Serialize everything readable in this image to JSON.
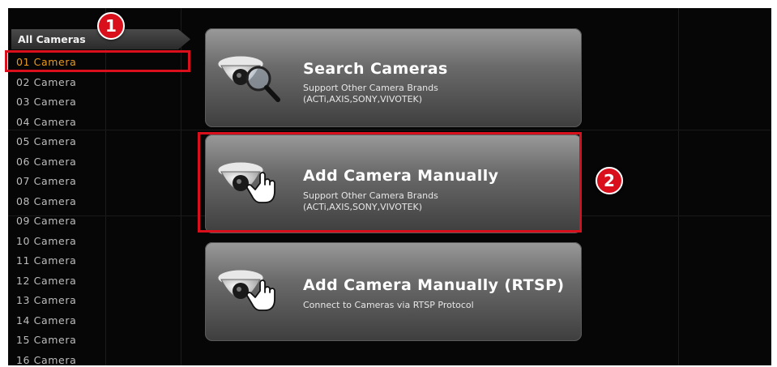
{
  "sidebar": {
    "header": "All Cameras",
    "items": [
      {
        "label": "01 Camera",
        "selected": true
      },
      {
        "label": "02 Camera"
      },
      {
        "label": "03 Camera"
      },
      {
        "label": "04 Camera"
      },
      {
        "label": "05 Camera"
      },
      {
        "label": "06 Camera"
      },
      {
        "label": "07 Camera"
      },
      {
        "label": "08 Camera"
      },
      {
        "label": "09 Camera"
      },
      {
        "label": "10 Camera"
      },
      {
        "label": "11 Camera"
      },
      {
        "label": "12 Camera"
      },
      {
        "label": "13 Camera"
      },
      {
        "label": "14 Camera"
      },
      {
        "label": "15 Camera"
      },
      {
        "label": "16 Camera"
      }
    ]
  },
  "options": [
    {
      "title": "Search Cameras",
      "subtitle_line1": "Support Other Camera Brands",
      "subtitle_line2": "(ACTi,AXIS,SONY,VIVOTEK)",
      "icon": "camera-search-icon"
    },
    {
      "title": "Add Camera Manually",
      "subtitle_line1": "Support Other Camera Brands",
      "subtitle_line2": "(ACTi,AXIS,SONY,VIVOTEK)",
      "icon": "camera-hand-icon"
    },
    {
      "title": "Add Camera Manually (RTSP)",
      "subtitle_line1": "Connect to Cameras via RTSP Protocol",
      "icon": "camera-hand-icon"
    }
  ],
  "annotations": {
    "step1": "1",
    "step2": "2",
    "color": "#d9101c"
  },
  "colors": {
    "selected_text": "#e89a1e",
    "list_text": "#bdbdbd",
    "background": "#060606"
  }
}
